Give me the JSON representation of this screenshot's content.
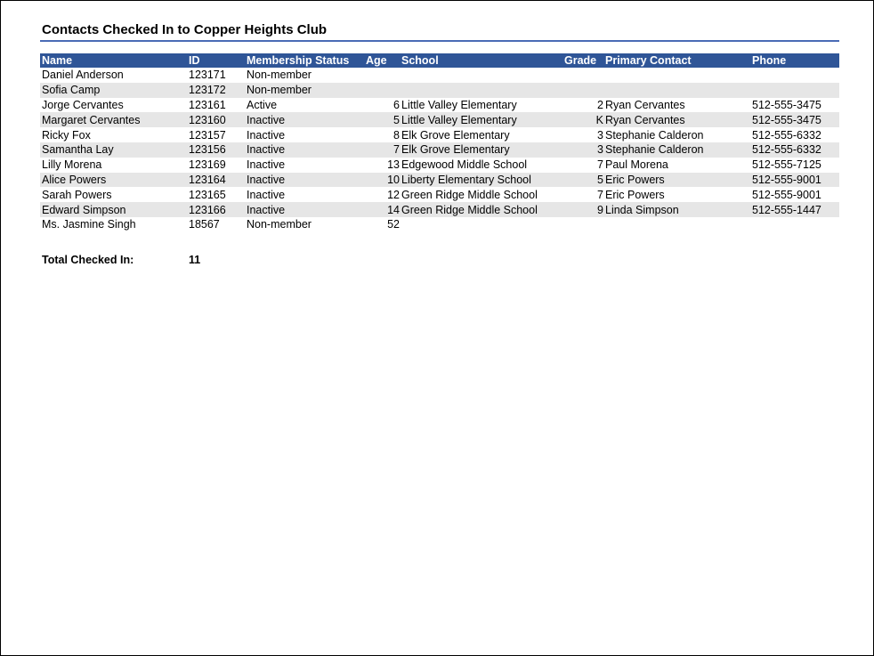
{
  "report": {
    "title": "Contacts Checked In to Copper Heights Club"
  },
  "columns": {
    "name": "Name",
    "id": "ID",
    "membership": "Membership Status",
    "age": "Age",
    "school": "School",
    "grade": "Grade",
    "primary_contact": "Primary Contact",
    "phone": "Phone"
  },
  "rows": [
    {
      "name": "Daniel Anderson",
      "id": "123171",
      "membership": "Non-member",
      "age": "",
      "school": "",
      "grade": "",
      "primary_contact": "",
      "phone": ""
    },
    {
      "name": "Sofia Camp",
      "id": "123172",
      "membership": "Non-member",
      "age": "",
      "school": "",
      "grade": "",
      "primary_contact": "",
      "phone": ""
    },
    {
      "name": "Jorge Cervantes",
      "id": "123161",
      "membership": "Active",
      "age": "6",
      "school": "Little Valley Elementary",
      "grade": "2",
      "primary_contact": "Ryan Cervantes",
      "phone": "512-555-3475"
    },
    {
      "name": "Margaret Cervantes",
      "id": "123160",
      "membership": "Inactive",
      "age": "5",
      "school": "Little Valley Elementary",
      "grade": "K",
      "primary_contact": "Ryan Cervantes",
      "phone": "512-555-3475"
    },
    {
      "name": "Ricky Fox",
      "id": "123157",
      "membership": "Inactive",
      "age": "8",
      "school": "Elk Grove Elementary",
      "grade": "3",
      "primary_contact": "Stephanie Calderon",
      "phone": "512-555-6332"
    },
    {
      "name": "Samantha Lay",
      "id": "123156",
      "membership": "Inactive",
      "age": "7",
      "school": "Elk Grove Elementary",
      "grade": "3",
      "primary_contact": "Stephanie Calderon",
      "phone": "512-555-6332"
    },
    {
      "name": "Lilly Morena",
      "id": "123169",
      "membership": "Inactive",
      "age": "13",
      "school": "Edgewood Middle School",
      "grade": "7",
      "primary_contact": "Paul Morena",
      "phone": "512-555-7125"
    },
    {
      "name": "Alice Powers",
      "id": "123164",
      "membership": "Inactive",
      "age": "10",
      "school": "Liberty Elementary School",
      "grade": "5",
      "primary_contact": "Eric Powers",
      "phone": "512-555-9001"
    },
    {
      "name": "Sarah Powers",
      "id": "123165",
      "membership": "Inactive",
      "age": "12",
      "school": "Green Ridge Middle School",
      "grade": "7",
      "primary_contact": "Eric Powers",
      "phone": "512-555-9001"
    },
    {
      "name": "Edward Simpson",
      "id": "123166",
      "membership": "Inactive",
      "age": "14",
      "school": "Green Ridge Middle School",
      "grade": "9",
      "primary_contact": "Linda Simpson",
      "phone": "512-555-1447"
    },
    {
      "name": "Ms. Jasmine Singh",
      "id": "18567",
      "membership": "Non-member",
      "age": "52",
      "school": "",
      "grade": "",
      "primary_contact": "",
      "phone": ""
    }
  ],
  "summary": {
    "total_label": "Total Checked In:",
    "total_value": "11"
  },
  "colors": {
    "header_fill": "#2f5597",
    "title_rule": "#4a6bb5",
    "stripe_fill": "#e6e6e6"
  }
}
